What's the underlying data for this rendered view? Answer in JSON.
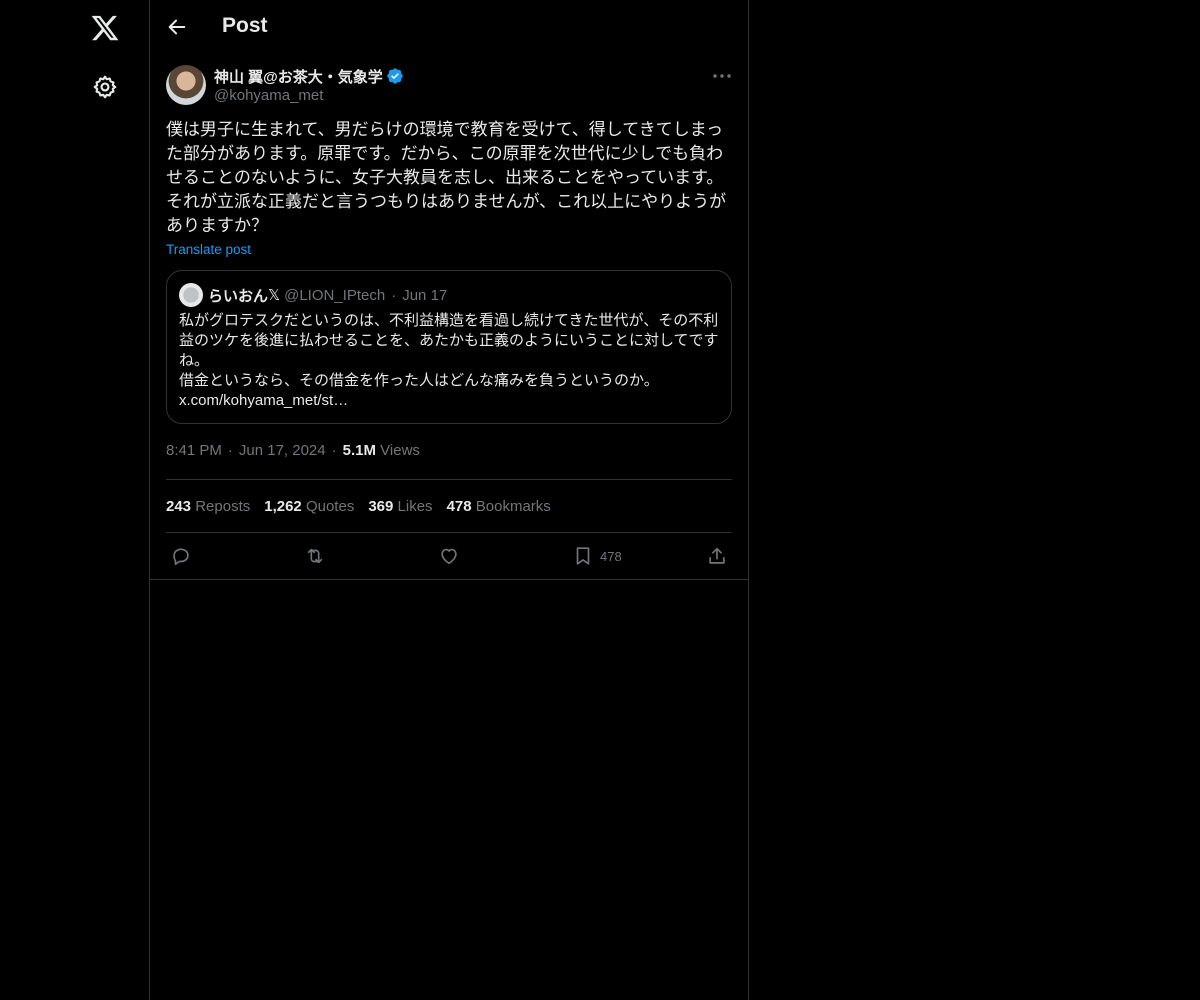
{
  "header": {
    "title": "Post"
  },
  "author": {
    "name": "神山 翼@お茶大・気象学",
    "handle": "@kohyama_met"
  },
  "post": {
    "text": "僕は男子に生まれて、男だらけの環境で教育を受けて、得してきてしまった部分があります。原罪です。だから、この原罪を次世代に少しでも負わせることのないように、女子大教員を志し、出来ることをやっています。それが立派な正義だと言うつもりはありませんが、これ以上にやりようがありますか？",
    "translate_label": "Translate post"
  },
  "quote": {
    "name": "らいおん",
    "x_glyph": "𝕏",
    "handle": "@LION_IPtech",
    "date": "Jun 17",
    "text": "私がグロテスクだというのは、不利益構造を看過し続けてきた世代が、その不利益のツケを後進に払わせることを、あたかも正義のようにいうことに対してですね。\n借金というなら、その借金を作った人はどんな痛みを負うというのか。\nx.com/kohyama_met/st…"
  },
  "meta": {
    "time": "8:41 PM",
    "date": "Jun 17, 2024",
    "views_count": "5.1M",
    "views_label": "Views"
  },
  "stats": {
    "reposts_count": "243",
    "reposts_label": "Reposts",
    "quotes_count": "1,262",
    "quotes_label": "Quotes",
    "likes_count": "369",
    "likes_label": "Likes",
    "bookmarks_count": "478",
    "bookmarks_label": "Bookmarks"
  },
  "actions": {
    "bookmark_count": "478"
  },
  "icons": {
    "logo": "x-logo-icon",
    "settings": "gear-icon",
    "back": "arrow-left-icon",
    "verified": "verified-badge-icon",
    "more": "more-dots-icon",
    "reply": "reply-icon",
    "repost": "repost-icon",
    "like": "heart-icon",
    "bookmark": "bookmark-icon",
    "share": "share-icon"
  },
  "colors": {
    "background": "#000000",
    "text": "#e7e9ea",
    "muted": "#71767b",
    "link": "#1d9bf0",
    "border": "#2f3336"
  }
}
